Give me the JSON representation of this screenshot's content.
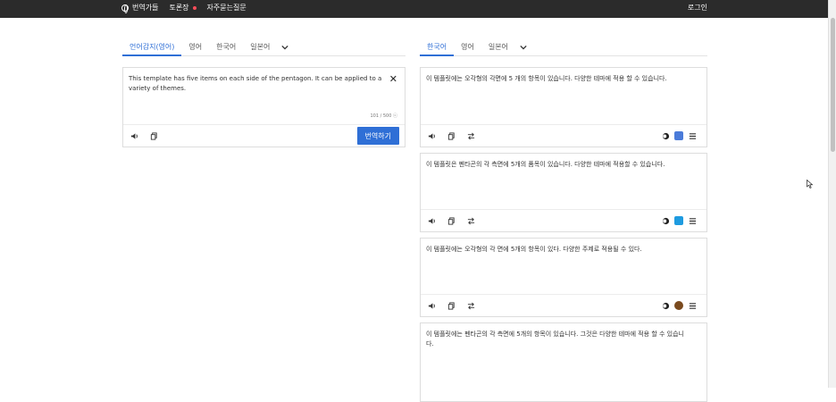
{
  "topbar": {
    "languages_label": "번역가들",
    "community_label": "토론장",
    "faq_label": "자주묻는질문",
    "login_label": "로그인"
  },
  "source": {
    "tabs": [
      "언어감지(영어)",
      "영어",
      "한국어",
      "일본어"
    ],
    "text": "This template has five items on each side of the pentagon. It can be applied to a variety of themes.",
    "count": "101 / 500 ⓒ",
    "translate_button": "번역하기"
  },
  "target": {
    "tabs": [
      "한국어",
      "영어",
      "일본어"
    ],
    "results": [
      {
        "text": "이 템플릿에는 오각형의 각면에 5 개의 항목이 있습니다. 다양한 테마에 적용 할 수 있습니다.",
        "provider": "google",
        "provider_color": "#4a7bd9"
      },
      {
        "text": "이 템플릿은 펜타곤의 각 측면에 5개의 품목이 있습니다. 다양한 테마에 적용할 수 있습니다.",
        "provider": "bing",
        "provider_color": "#1e9be0"
      },
      {
        "text": "이 템플릿에는 오각형의 각 면에 5개의 항목이 있다. 다양한 주제로 적용될 수 있다.",
        "provider": "kakao",
        "provider_color": "#7a4a1e"
      },
      {
        "text": "이 템플릿에는 펜타곤의 각 측면에 5개의 항목이 있습니다. 그것은 다양한 테마에 적용 할 수 있습니다.",
        "provider": "other",
        "provider_color": "#e08a1e"
      }
    ]
  },
  "colors": {
    "accent": "#2f6fd6",
    "topbar": "#2b2b2b"
  }
}
